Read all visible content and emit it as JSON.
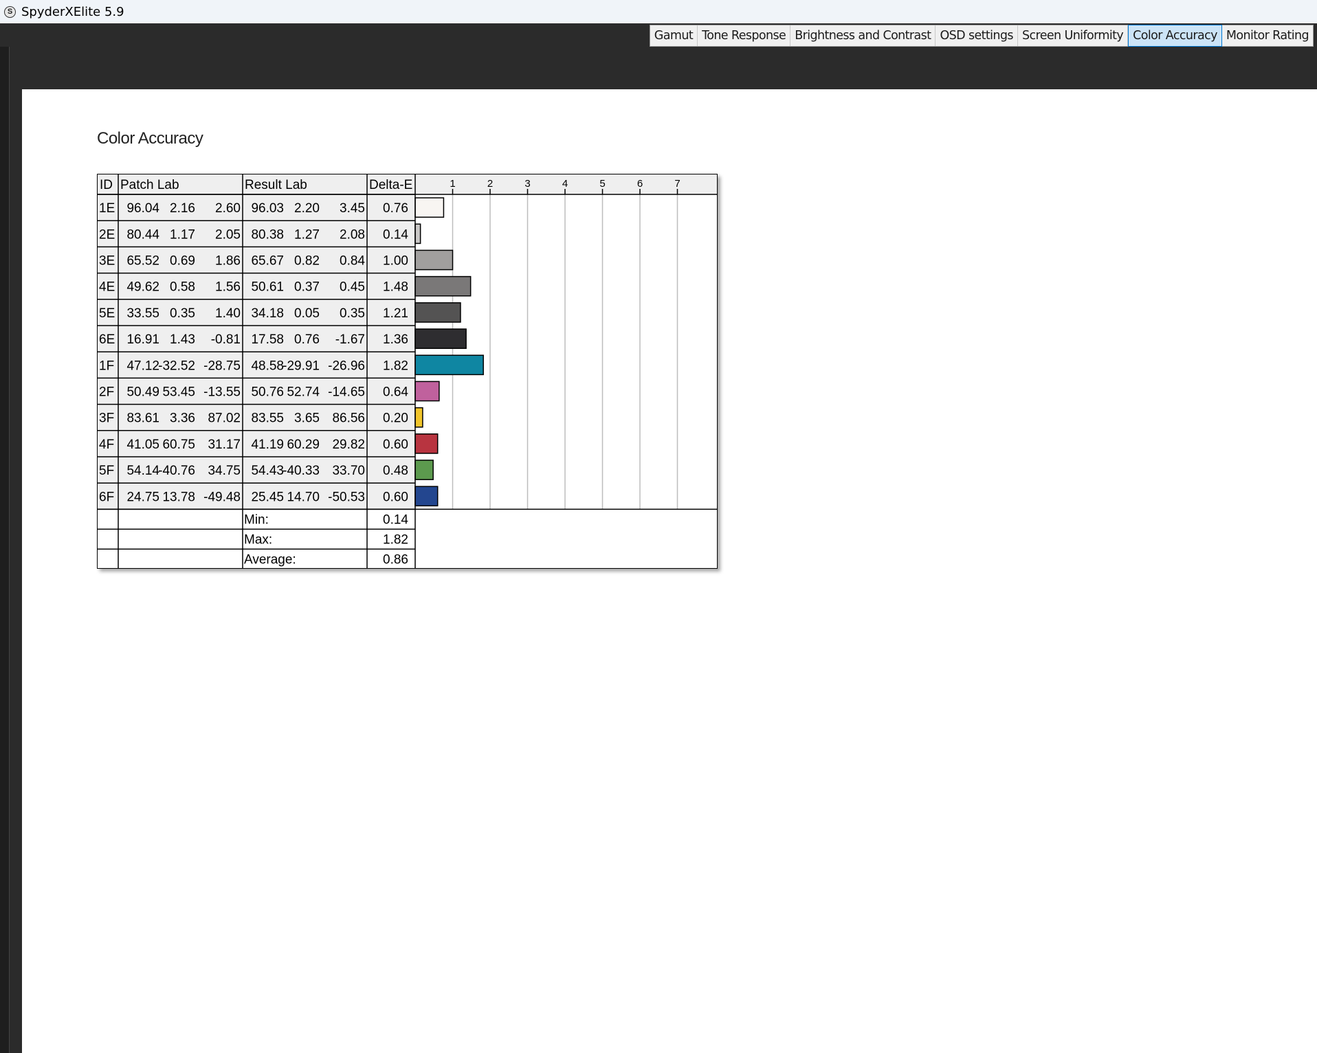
{
  "app": {
    "title": "SpyderXElite 5.9",
    "icon_label": "S"
  },
  "tabs": [
    {
      "label": "Gamut",
      "active": false
    },
    {
      "label": "Tone Response",
      "active": false
    },
    {
      "label": "Brightness and Contrast",
      "active": false
    },
    {
      "label": "OSD settings",
      "active": false
    },
    {
      "label": "Screen Uniformity",
      "active": false
    },
    {
      "label": "Color Accuracy",
      "active": true
    },
    {
      "label": "Monitor Rating",
      "active": false
    }
  ],
  "page": {
    "title": "Color Accuracy"
  },
  "table": {
    "headers": {
      "id": "ID",
      "patch": "Patch Lab",
      "result": "Result Lab",
      "delta": "Delta-E"
    },
    "rows": [
      {
        "id": "1E",
        "patch": [
          "96.04",
          "2.16",
          "2.60"
        ],
        "result": [
          "96.03",
          "2.20",
          "3.45"
        ],
        "delta": "0.76",
        "color": "#f8f5f2"
      },
      {
        "id": "2E",
        "patch": [
          "80.44",
          "1.17",
          "2.05"
        ],
        "result": [
          "80.38",
          "1.27",
          "2.08"
        ],
        "delta": "0.14",
        "color": "#c9c7c6"
      },
      {
        "id": "3E",
        "patch": [
          "65.52",
          "0.69",
          "1.86"
        ],
        "result": [
          "65.67",
          "0.82",
          "0.84"
        ],
        "delta": "1.00",
        "color": "#a19f9e"
      },
      {
        "id": "4E",
        "patch": [
          "49.62",
          "0.58",
          "1.56"
        ],
        "result": [
          "50.61",
          "0.37",
          "0.45"
        ],
        "delta": "1.48",
        "color": "#7a7878"
      },
      {
        "id": "5E",
        "patch": [
          "33.55",
          "0.35",
          "1.40"
        ],
        "result": [
          "34.18",
          "0.05",
          "0.35"
        ],
        "delta": "1.21",
        "color": "#545353"
      },
      {
        "id": "6E",
        "patch": [
          "16.91",
          "1.43",
          "-0.81"
        ],
        "result": [
          "17.58",
          "0.76",
          "-1.67"
        ],
        "delta": "1.36",
        "color": "#2e2d30"
      },
      {
        "id": "1F",
        "patch": [
          "47.12",
          "-32.52",
          "-28.75"
        ],
        "result": [
          "48.58",
          "-29.91",
          "-26.96"
        ],
        "delta": "1.82",
        "color": "#0f86a2"
      },
      {
        "id": "2F",
        "patch": [
          "50.49",
          "53.45",
          "-13.55"
        ],
        "result": [
          "50.76",
          "52.74",
          "-14.65"
        ],
        "delta": "0.64",
        "color": "#c0619d"
      },
      {
        "id": "3F",
        "patch": [
          "83.61",
          "3.36",
          "87.02"
        ],
        "result": [
          "83.55",
          "3.65",
          "86.56"
        ],
        "delta": "0.20",
        "color": "#f0c42a"
      },
      {
        "id": "4F",
        "patch": [
          "41.05",
          "60.75",
          "31.17"
        ],
        "result": [
          "41.19",
          "60.29",
          "29.82"
        ],
        "delta": "0.60",
        "color": "#b83440"
      },
      {
        "id": "5F",
        "patch": [
          "54.14",
          "-40.76",
          "34.75"
        ],
        "result": [
          "54.43",
          "-40.33",
          "33.70"
        ],
        "delta": "0.48",
        "color": "#5c9a4e"
      },
      {
        "id": "6F",
        "patch": [
          "24.75",
          "13.78",
          "-49.48"
        ],
        "result": [
          "25.45",
          "14.70",
          "-50.53"
        ],
        "delta": "0.60",
        "color": "#23468f"
      }
    ],
    "summary": [
      {
        "label": "Min:",
        "value": "0.14"
      },
      {
        "label": "Max:",
        "value": "1.82"
      },
      {
        "label": "Average:",
        "value": "0.86"
      }
    ]
  },
  "chart_data": {
    "type": "bar",
    "orientation": "horizontal",
    "categories": [
      "1E",
      "2E",
      "3E",
      "4E",
      "5E",
      "6E",
      "1F",
      "2F",
      "3F",
      "4F",
      "5F",
      "6F"
    ],
    "values": [
      0.76,
      0.14,
      1.0,
      1.48,
      1.21,
      1.36,
      1.82,
      0.64,
      0.2,
      0.6,
      0.48,
      0.6
    ],
    "tick_labels": [
      "1",
      "2",
      "3",
      "4",
      "5",
      "6",
      "7"
    ],
    "xlim": [
      0,
      8
    ],
    "grid": true
  }
}
